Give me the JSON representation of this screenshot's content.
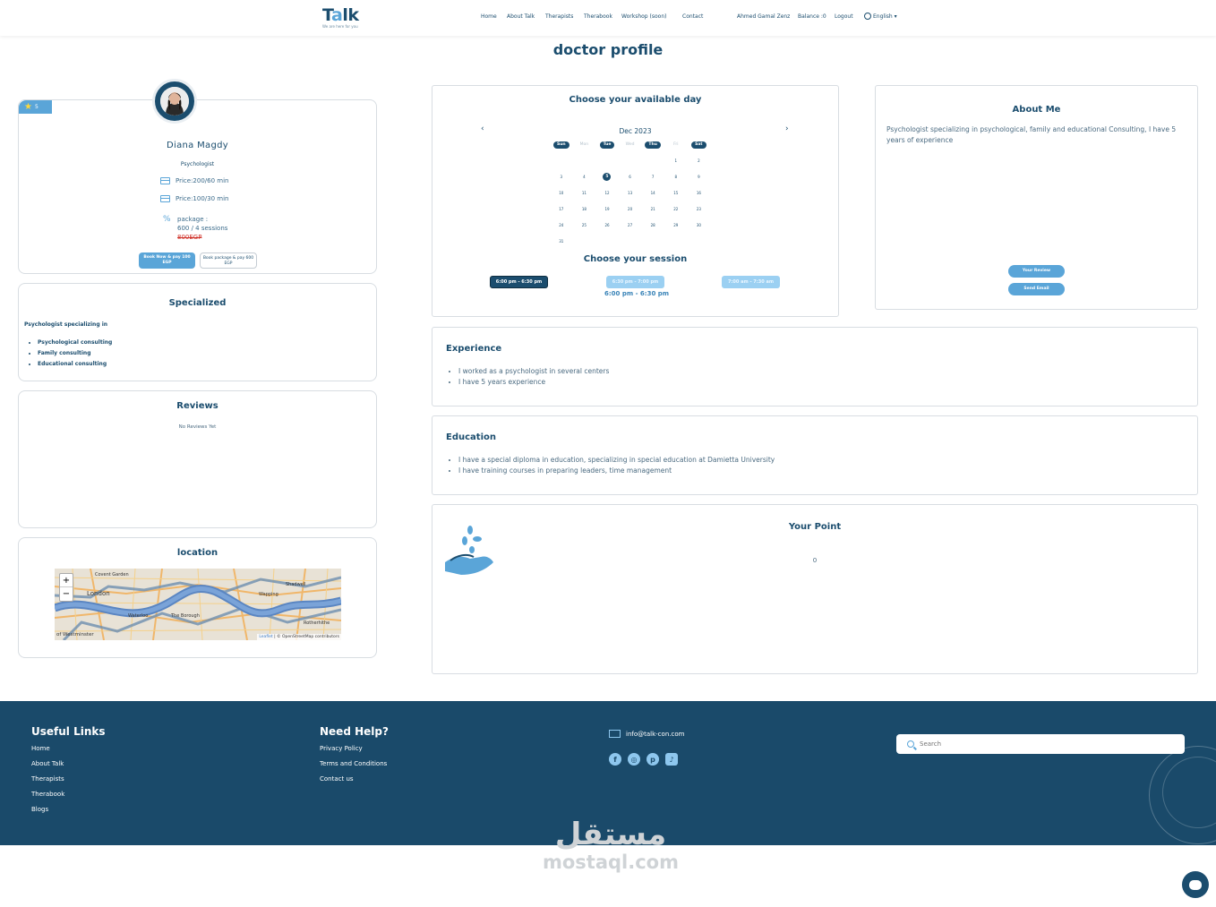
{
  "nav": {
    "logo_text_a": "T",
    "logo_text_o": "a",
    "logo_text_b": "lk",
    "logo_tagline": "We are here for you",
    "links": [
      "Home",
      "About Talk",
      "Therapists",
      "Therabook",
      "Workshop (soon)",
      "Contact"
    ],
    "user": "Ahmed Gamal Zenz",
    "balance": "Balance :0",
    "logout": "Logout",
    "language": "English"
  },
  "page_title": "doctor profile",
  "profile": {
    "rating": "5",
    "name": "Diana Magdy",
    "title": "Psychologist",
    "price1": "Price:200/60 min",
    "price2": "Price:100/30 min",
    "package_label": "package :",
    "package_detail": "600 / 4 sessions",
    "package_old": "800EGP",
    "book_now": "Book Now & pay 100 EGP",
    "book_package": "Book package & pay 600 EGP"
  },
  "specialized": {
    "title": "Specialized",
    "intro": "Psychologist specializing in",
    "items": [
      "Psychological consulting",
      "Family consulting",
      "Educational consulting"
    ]
  },
  "reviews": {
    "title": "Reviews",
    "empty": "No Reviews Yet"
  },
  "location": {
    "title": "location",
    "zoom_in": "+",
    "zoom_out": "−",
    "attr_leaflet": "Leaflet",
    "attr_osm": "| © OpenStreetMap contributors",
    "places": [
      "Covent Garden",
      "London",
      "Wapping",
      "Shadwell",
      "Waterloo",
      "The Borough",
      "Rotherhithe",
      "of Westminster"
    ]
  },
  "calendar": {
    "title": "Choose your available day",
    "month": "Dec 2023",
    "prev": "‹",
    "next": "›",
    "dow": [
      {
        "label": "Sun",
        "on": true
      },
      {
        "label": "Mon",
        "on": false
      },
      {
        "label": "Tue",
        "on": true
      },
      {
        "label": "Wed",
        "on": false
      },
      {
        "label": "Thu",
        "on": true
      },
      {
        "label": "Fri",
        "on": false
      },
      {
        "label": "Sat",
        "on": true
      }
    ],
    "days": [
      "",
      "",
      "",
      "",
      "",
      "1",
      "2",
      "3",
      "4",
      "5",
      "6",
      "7",
      "8",
      "9",
      "10",
      "11",
      "12",
      "13",
      "14",
      "15",
      "16",
      "17",
      "18",
      "19",
      "20",
      "21",
      "22",
      "23",
      "24",
      "25",
      "26",
      "27",
      "28",
      "29",
      "30",
      "31",
      "",
      "",
      "",
      "",
      "",
      ""
    ],
    "selected_day": "5",
    "session_title": "Choose your session",
    "sessions": [
      "6:00 pm - 6:30 pm",
      "6:30 pm - 7:00 pm",
      "7:00 am - 7:30 am"
    ],
    "selected_session": "6:00 pm - 6:30 pm"
  },
  "about": {
    "title": "About Me",
    "text": "Psychologist specializing in psychological, family and educational Consulting, I have 5 years of experience",
    "review_btn": "Your Review",
    "email_btn": "Send Email"
  },
  "experience": {
    "title": "Experience",
    "items": [
      "I worked as a psychologist in several centers",
      "I have 5 years experience"
    ]
  },
  "education": {
    "title": "Education",
    "items": [
      "I have a special diploma in education, specializing in special education at Damietta University",
      "I have training courses in preparing leaders, time management"
    ]
  },
  "points": {
    "title": "Your Point",
    "value": "0"
  },
  "footer": {
    "useful_title": "Useful Links",
    "useful_links": [
      "Home",
      "About Talk",
      "Therapists",
      "Therabook",
      "Blogs"
    ],
    "help_title": "Need Help?",
    "help_links": [
      "Privacy Policy",
      "Terms and Conditions",
      "Contact us"
    ],
    "email": "info@talk-con.com",
    "search_placeholder": "Search"
  },
  "watermark": {
    "arabic": "مستقل",
    "latin": "mostaql.com"
  },
  "colors": {
    "primary": "#1b4d6e",
    "accent": "#5aa5d8",
    "footer_bg": "#1a4a6a"
  }
}
